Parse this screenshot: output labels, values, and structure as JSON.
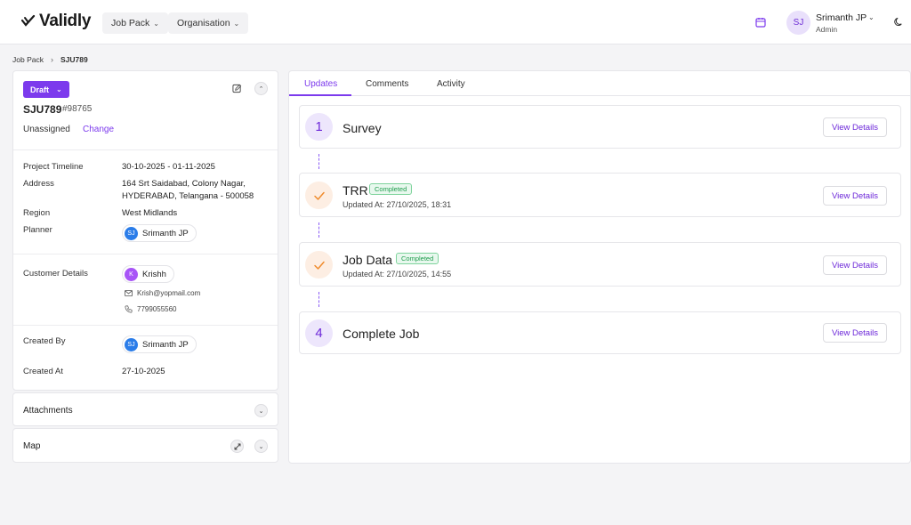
{
  "header": {
    "logo_text": "Validly",
    "nav": [
      {
        "label": "Job Pack"
      },
      {
        "label": "Organisation"
      }
    ],
    "user": {
      "initials": "SJ",
      "name": "Srimanth JP",
      "role": "Admin"
    }
  },
  "breadcrumb": {
    "parent": "Job Pack",
    "current": "SJU789"
  },
  "job": {
    "status": "Draft",
    "code": "SJU789",
    "number": "#98765",
    "assignee": "Unassigned",
    "change_label": "Change",
    "details": {
      "timeline_label": "Project Timeline",
      "timeline": "30-10-2025 - 01-11-2025",
      "address_label": "Address",
      "address_line1": "164 Srt Saidabad, Colony Nagar,",
      "address_line2": "HYDERABAD, Telangana - 500058",
      "region_label": "Region",
      "region": "West Midlands",
      "planner_label": "Planner",
      "planner_initials": "SJ",
      "planner": "Srimanth JP"
    },
    "customer": {
      "label": "Customer Details",
      "initials": "K",
      "name": "Krishh",
      "email": "Krish@yopmail.com",
      "phone": "7799055560"
    },
    "created_by_label": "Created By",
    "created_by_initials": "SJ",
    "created_by": "Srimanth JP",
    "created_at_label": "Created At",
    "created_at": "27-10-2025"
  },
  "sections": {
    "attachments": "Attachments",
    "map": "Map"
  },
  "tabs": [
    {
      "label": "Updates",
      "active": true
    },
    {
      "label": "Comments",
      "active": false
    },
    {
      "label": "Activity",
      "active": false
    }
  ],
  "steps": [
    {
      "marker": "1",
      "title": "Survey",
      "state": "pending",
      "button": "View Details"
    },
    {
      "marker": "check",
      "title": "TRR",
      "state": "completed",
      "badge": "Completed",
      "updated": "Updated At: 27/10/2025, 18:31",
      "button": "View Details"
    },
    {
      "marker": "check",
      "title": "Job Data",
      "state": "completed",
      "badge": "Completed",
      "updated": "Updated At: 27/10/2025, 14:55",
      "button": "View Details"
    },
    {
      "marker": "4",
      "title": "Complete Job",
      "state": "pending",
      "button": "View Details"
    }
  ],
  "colors": {
    "accent": "#7c3aed",
    "success": "#1f9d4d",
    "check": "#f08c2e"
  }
}
